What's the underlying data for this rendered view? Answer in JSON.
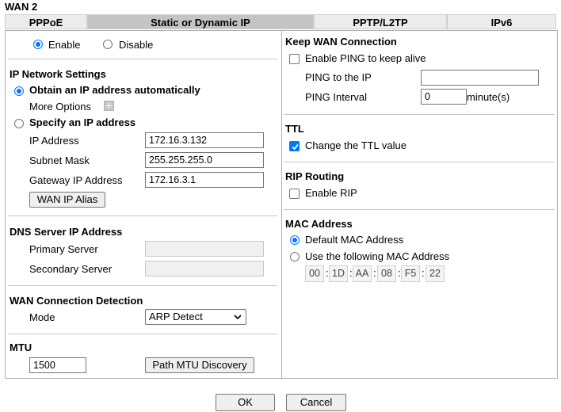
{
  "page_title": "WAN 2",
  "tabs": [
    {
      "label": "PPPoE",
      "active": false
    },
    {
      "label": "Static or Dynamic IP",
      "active": true
    },
    {
      "label": "PPTP/L2TP",
      "active": false
    },
    {
      "label": "IPv6",
      "active": false
    }
  ],
  "enable_radio": {
    "enable_label": "Enable",
    "disable_label": "Disable",
    "selected": "Enable"
  },
  "ip_settings": {
    "title": "IP Network Settings",
    "obtain_label": "Obtain an IP address automatically",
    "more_options_label": "More Options",
    "specify_label": "Specify an IP address",
    "selected": "obtain",
    "ip_address_label": "IP Address",
    "ip_address_value": "172.16.3.132",
    "subnet_mask_label": "Subnet Mask",
    "subnet_mask_value": "255.255.255.0",
    "gateway_label": "Gateway IP Address",
    "gateway_value": "172.16.3.1",
    "wan_ip_alias_label": "WAN IP Alias"
  },
  "dns": {
    "title": "DNS Server IP Address",
    "primary_label": "Primary Server",
    "primary_value": "",
    "secondary_label": "Secondary Server",
    "secondary_value": ""
  },
  "detection": {
    "title": "WAN Connection Detection",
    "mode_label": "Mode",
    "mode_value": "ARP Detect"
  },
  "mtu": {
    "title": "MTU",
    "value": "1500",
    "path_mtu_label": "Path MTU Discovery"
  },
  "keep_wan": {
    "title": "Keep WAN Connection",
    "enable_ping_label": "Enable PING to keep alive",
    "enable_ping_checked": false,
    "ping_to_ip_label": "PING to the IP",
    "ping_to_ip_value": "",
    "ping_interval_label": "PING Interval",
    "ping_interval_value": "0",
    "ping_interval_unit": "minute(s)"
  },
  "ttl": {
    "title": "TTL",
    "change_label": "Change the TTL value",
    "checked": true
  },
  "rip": {
    "title": "RIP Routing",
    "enable_label": "Enable RIP",
    "checked": false
  },
  "mac": {
    "title": "MAC Address",
    "default_label": "Default MAC Address",
    "following_label": "Use the following MAC Address",
    "selected": "default",
    "octets": [
      "00",
      "1D",
      "AA",
      "08",
      "F5",
      "22"
    ]
  },
  "footer": {
    "ok_label": "OK",
    "cancel_label": "Cancel"
  },
  "colors": {
    "accent": "#0075ff",
    "active_tab": "#c4c4c4",
    "inactive_tab": "#ececec"
  }
}
